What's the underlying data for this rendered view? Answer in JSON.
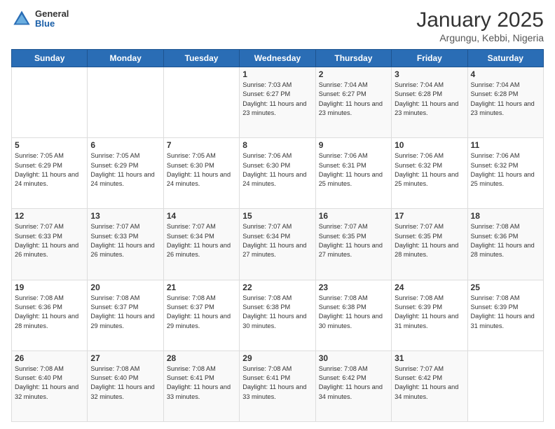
{
  "header": {
    "logo_general": "General",
    "logo_blue": "Blue",
    "title": "January 2025",
    "location": "Argungu, Kebbi, Nigeria"
  },
  "weekdays": [
    "Sunday",
    "Monday",
    "Tuesday",
    "Wednesday",
    "Thursday",
    "Friday",
    "Saturday"
  ],
  "weeks": [
    [
      {
        "day": "",
        "info": ""
      },
      {
        "day": "",
        "info": ""
      },
      {
        "day": "",
        "info": ""
      },
      {
        "day": "1",
        "info": "Sunrise: 7:03 AM\nSunset: 6:27 PM\nDaylight: 11 hours\nand 23 minutes."
      },
      {
        "day": "2",
        "info": "Sunrise: 7:04 AM\nSunset: 6:27 PM\nDaylight: 11 hours\nand 23 minutes."
      },
      {
        "day": "3",
        "info": "Sunrise: 7:04 AM\nSunset: 6:28 PM\nDaylight: 11 hours\nand 23 minutes."
      },
      {
        "day": "4",
        "info": "Sunrise: 7:04 AM\nSunset: 6:28 PM\nDaylight: 11 hours\nand 23 minutes."
      }
    ],
    [
      {
        "day": "5",
        "info": "Sunrise: 7:05 AM\nSunset: 6:29 PM\nDaylight: 11 hours\nand 24 minutes."
      },
      {
        "day": "6",
        "info": "Sunrise: 7:05 AM\nSunset: 6:29 PM\nDaylight: 11 hours\nand 24 minutes."
      },
      {
        "day": "7",
        "info": "Sunrise: 7:05 AM\nSunset: 6:30 PM\nDaylight: 11 hours\nand 24 minutes."
      },
      {
        "day": "8",
        "info": "Sunrise: 7:06 AM\nSunset: 6:30 PM\nDaylight: 11 hours\nand 24 minutes."
      },
      {
        "day": "9",
        "info": "Sunrise: 7:06 AM\nSunset: 6:31 PM\nDaylight: 11 hours\nand 25 minutes."
      },
      {
        "day": "10",
        "info": "Sunrise: 7:06 AM\nSunset: 6:32 PM\nDaylight: 11 hours\nand 25 minutes."
      },
      {
        "day": "11",
        "info": "Sunrise: 7:06 AM\nSunset: 6:32 PM\nDaylight: 11 hours\nand 25 minutes."
      }
    ],
    [
      {
        "day": "12",
        "info": "Sunrise: 7:07 AM\nSunset: 6:33 PM\nDaylight: 11 hours\nand 26 minutes."
      },
      {
        "day": "13",
        "info": "Sunrise: 7:07 AM\nSunset: 6:33 PM\nDaylight: 11 hours\nand 26 minutes."
      },
      {
        "day": "14",
        "info": "Sunrise: 7:07 AM\nSunset: 6:34 PM\nDaylight: 11 hours\nand 26 minutes."
      },
      {
        "day": "15",
        "info": "Sunrise: 7:07 AM\nSunset: 6:34 PM\nDaylight: 11 hours\nand 27 minutes."
      },
      {
        "day": "16",
        "info": "Sunrise: 7:07 AM\nSunset: 6:35 PM\nDaylight: 11 hours\nand 27 minutes."
      },
      {
        "day": "17",
        "info": "Sunrise: 7:07 AM\nSunset: 6:35 PM\nDaylight: 11 hours\nand 28 minutes."
      },
      {
        "day": "18",
        "info": "Sunrise: 7:08 AM\nSunset: 6:36 PM\nDaylight: 11 hours\nand 28 minutes."
      }
    ],
    [
      {
        "day": "19",
        "info": "Sunrise: 7:08 AM\nSunset: 6:36 PM\nDaylight: 11 hours\nand 28 minutes."
      },
      {
        "day": "20",
        "info": "Sunrise: 7:08 AM\nSunset: 6:37 PM\nDaylight: 11 hours\nand 29 minutes."
      },
      {
        "day": "21",
        "info": "Sunrise: 7:08 AM\nSunset: 6:37 PM\nDaylight: 11 hours\nand 29 minutes."
      },
      {
        "day": "22",
        "info": "Sunrise: 7:08 AM\nSunset: 6:38 PM\nDaylight: 11 hours\nand 30 minutes."
      },
      {
        "day": "23",
        "info": "Sunrise: 7:08 AM\nSunset: 6:38 PM\nDaylight: 11 hours\nand 30 minutes."
      },
      {
        "day": "24",
        "info": "Sunrise: 7:08 AM\nSunset: 6:39 PM\nDaylight: 11 hours\nand 31 minutes."
      },
      {
        "day": "25",
        "info": "Sunrise: 7:08 AM\nSunset: 6:39 PM\nDaylight: 11 hours\nand 31 minutes."
      }
    ],
    [
      {
        "day": "26",
        "info": "Sunrise: 7:08 AM\nSunset: 6:40 PM\nDaylight: 11 hours\nand 32 minutes."
      },
      {
        "day": "27",
        "info": "Sunrise: 7:08 AM\nSunset: 6:40 PM\nDaylight: 11 hours\nand 32 minutes."
      },
      {
        "day": "28",
        "info": "Sunrise: 7:08 AM\nSunset: 6:41 PM\nDaylight: 11 hours\nand 33 minutes."
      },
      {
        "day": "29",
        "info": "Sunrise: 7:08 AM\nSunset: 6:41 PM\nDaylight: 11 hours\nand 33 minutes."
      },
      {
        "day": "30",
        "info": "Sunrise: 7:08 AM\nSunset: 6:42 PM\nDaylight: 11 hours\nand 34 minutes."
      },
      {
        "day": "31",
        "info": "Sunrise: 7:07 AM\nSunset: 6:42 PM\nDaylight: 11 hours\nand 34 minutes."
      },
      {
        "day": "",
        "info": ""
      }
    ]
  ]
}
